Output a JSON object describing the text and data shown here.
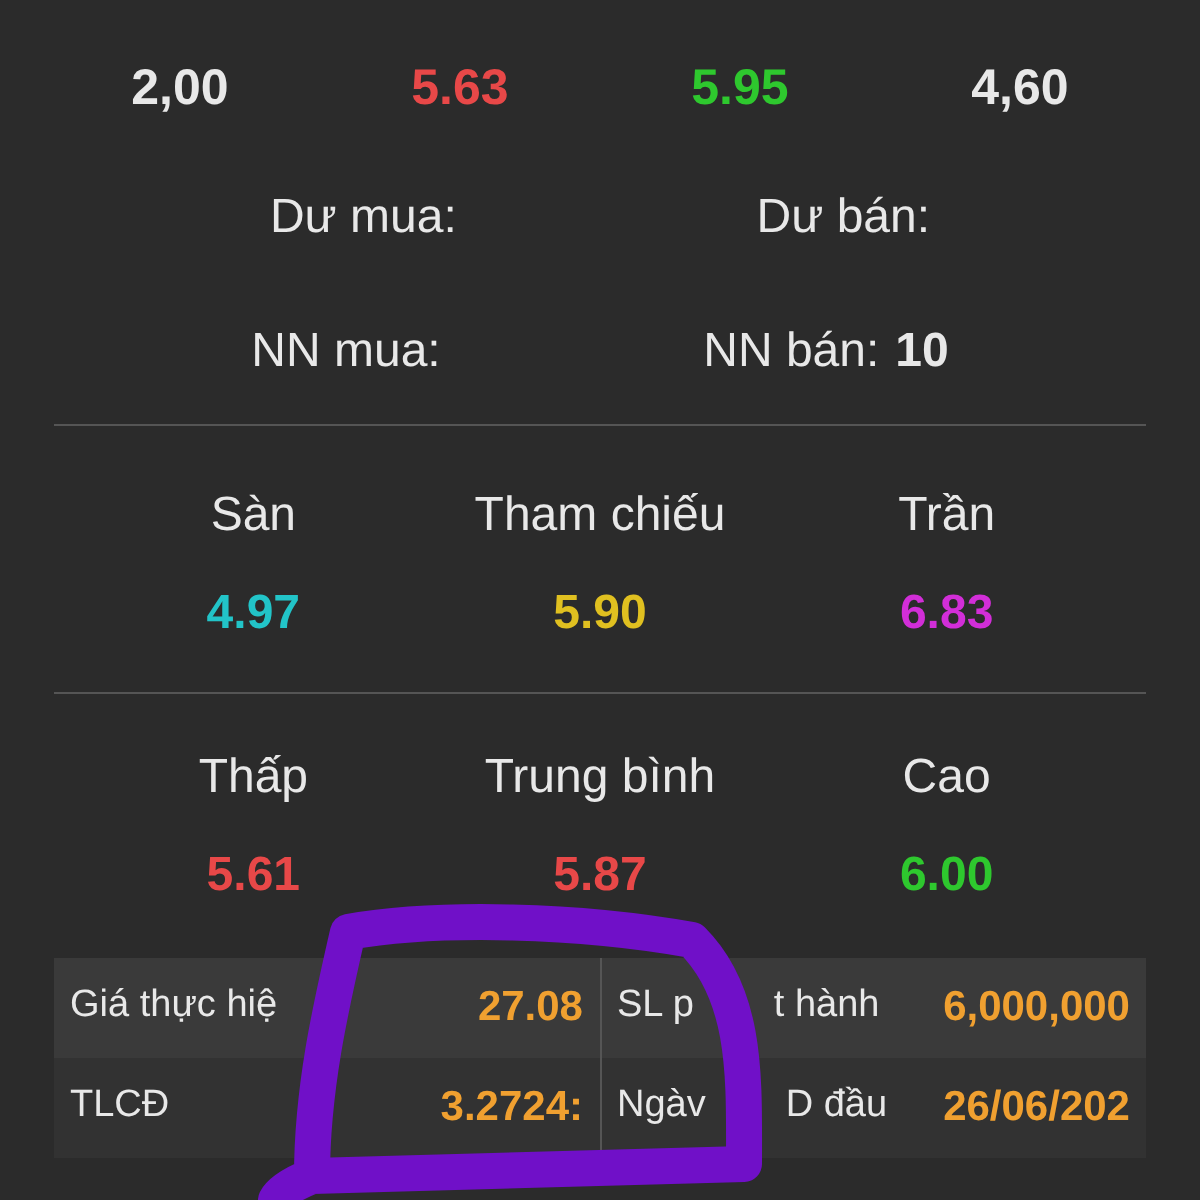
{
  "price_row": [
    {
      "text": "2,00",
      "color": "#e8e8e8"
    },
    {
      "text": "5.63",
      "color": "#e84848"
    },
    {
      "text": "5.95",
      "color": "#2ec82e"
    },
    {
      "text": "4,60",
      "color": "#e8e8e8"
    }
  ],
  "balance": [
    {
      "label": "Dư mua:"
    },
    {
      "label": "Dư bán:"
    }
  ],
  "foreign": [
    {
      "label": "NN mua:"
    },
    {
      "label": "NN bán:",
      "value": "10"
    }
  ],
  "reference": [
    {
      "label": "Sàn",
      "value": "4.97",
      "color": "#22c4c8"
    },
    {
      "label": "Tham chiếu",
      "value": "5.90",
      "color": "#e0c020"
    },
    {
      "label": "Trần",
      "value": "6.83",
      "color": "#d22ed8"
    }
  ],
  "range": [
    {
      "label": "Thấp",
      "value": "5.61",
      "color": "#e84848"
    },
    {
      "label": "Trung bình",
      "value": "5.87",
      "color": "#e84848"
    },
    {
      "label": "Cao",
      "value": "6.00",
      "color": "#2ec82e"
    }
  ],
  "details": [
    {
      "cells": [
        {
          "label": [
            "Giá thực hiệ"
          ],
          "value": "27.08"
        },
        {
          "label": [
            "SL p",
            "t hành"
          ],
          "value": "6,000,000"
        }
      ]
    },
    {
      "cells": [
        {
          "label": [
            "TLCĐ"
          ],
          "value": "3.2724:"
        },
        {
          "label": [
            "Ngàv",
            "D đầu"
          ],
          "value": "26/06/202"
        }
      ]
    }
  ]
}
